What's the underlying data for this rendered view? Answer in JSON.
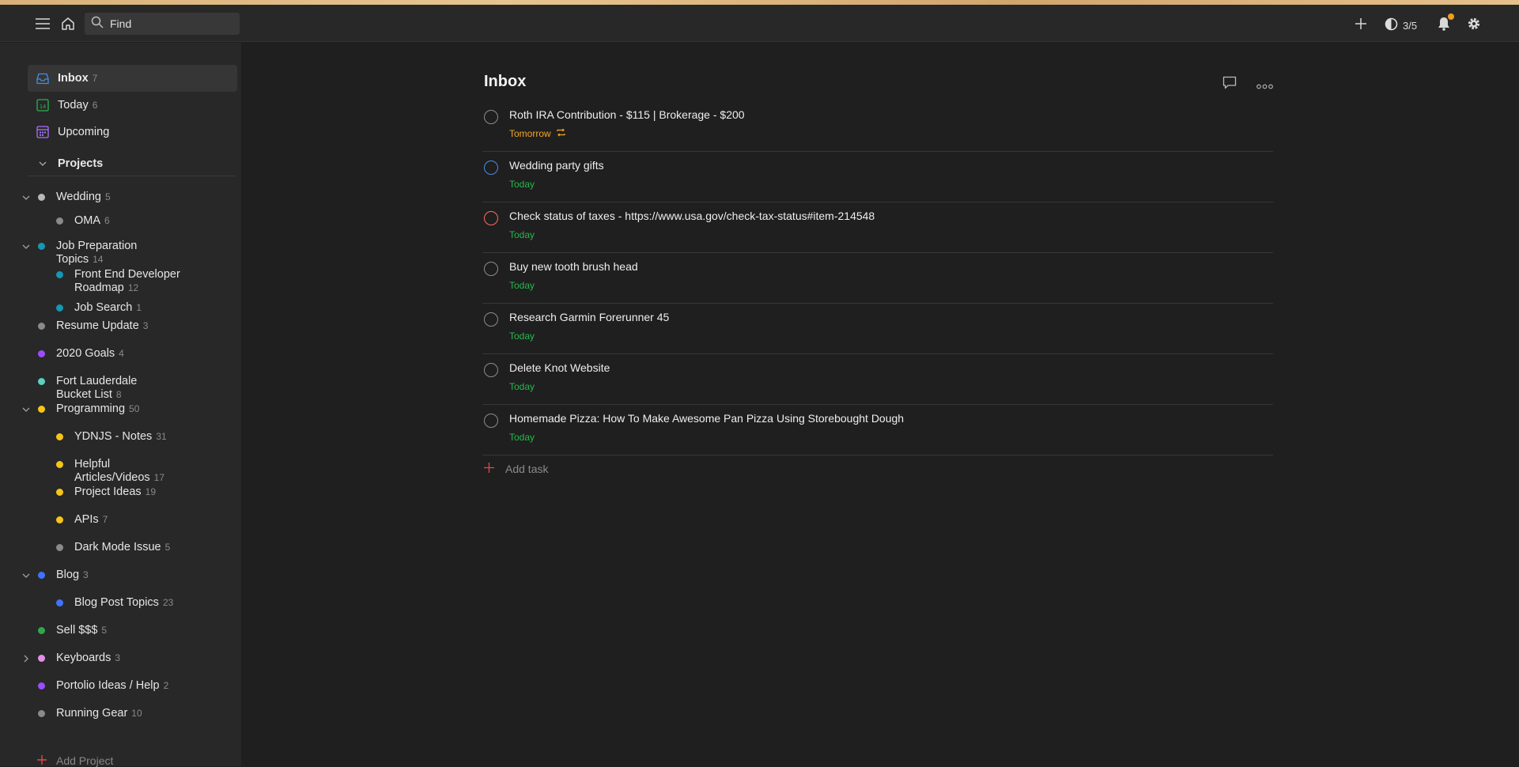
{
  "colors": {
    "accent_red": "#de4c4a",
    "today_green": "#25b84c",
    "tomorrow_orange": "#f5a623",
    "inbox_blue": "#4a8cdf",
    "today_icon_green": "#2bb24c",
    "upcoming_purple": "#a970ff"
  },
  "topbar": {
    "search_placeholder": "Find",
    "karma": "3/5",
    "icons": [
      "menu-icon",
      "home-icon",
      "search-icon",
      "plus-icon",
      "karma-icon",
      "bell-icon",
      "gear-icon"
    ]
  },
  "nav": {
    "inbox": {
      "label": "Inbox",
      "count": "7"
    },
    "today": {
      "label": "Today",
      "count": "6",
      "icon_text": "14"
    },
    "upcoming": {
      "label": "Upcoming"
    },
    "projects_label": "Projects"
  },
  "projects": [
    {
      "name": "Wedding",
      "count": "5",
      "color": "#b8b8b8",
      "expanded": true
    },
    {
      "name": "OMA",
      "count": "6",
      "color": "#8a8a8a"
    },
    {
      "name": "Job Preparation Topics",
      "count": "14",
      "color": "#1597b5",
      "expanded": true
    },
    {
      "name": "Front End Developer Roadmap",
      "count": "12",
      "color": "#1597b5"
    },
    {
      "name": "Job Search",
      "count": "1",
      "color": "#1597b5"
    },
    {
      "name": "Resume Update",
      "count": "3",
      "color": "#8a8a8a"
    },
    {
      "name": "2020 Goals",
      "count": "4",
      "color": "#9b4dff"
    },
    {
      "name": "Fort Lauderdale Bucket List",
      "count": "8",
      "color": "#5ecfc0"
    },
    {
      "name": "Programming",
      "count": "50",
      "color": "#f5c518",
      "expanded": true
    },
    {
      "name": "YDNJS - Notes",
      "count": "31",
      "color": "#f5c518"
    },
    {
      "name": "Helpful Articles/Videos",
      "count": "17",
      "color": "#f5c518"
    },
    {
      "name": "Project Ideas",
      "count": "19",
      "color": "#f5c518"
    },
    {
      "name": "APIs",
      "count": "7",
      "color": "#f5c518"
    },
    {
      "name": "Dark Mode Issue",
      "count": "5",
      "color": "#8a8a8a"
    },
    {
      "name": "Blog",
      "count": "3",
      "color": "#4073ff",
      "expanded": true
    },
    {
      "name": "Blog Post Topics",
      "count": "23",
      "color": "#4073ff"
    },
    {
      "name": "Sell $$$",
      "count": "5",
      "color": "#2ea84a"
    },
    {
      "name": "Keyboards",
      "count": "3",
      "color": "#e68ee8",
      "expanded": false
    },
    {
      "name": "Portolio Ideas / Help",
      "count": "2",
      "color": "#9b4dff"
    },
    {
      "name": "Running Gear",
      "count": "10",
      "color": "#8a8a8a"
    }
  ],
  "add_project_label": "Add Project",
  "main": {
    "title": "Inbox",
    "add_task_label": "Add task",
    "tasks": [
      {
        "name": "Roth IRA Contribution - $115 | Brokerage - $200",
        "due": "Tomorrow",
        "due_color": "#f5a623",
        "priority_color": "#8c8c8c",
        "recurring": true
      },
      {
        "name": "Wedding party gifts",
        "due": "Today",
        "due_color": "#25b84c",
        "priority_color": "#4a8cdf"
      },
      {
        "name": "Check status of taxes - https://www.usa.gov/check-tax-status#item-214548",
        "due": "Today",
        "due_color": "#25b84c",
        "priority_color": "#ff6b5b"
      },
      {
        "name": "Buy new tooth brush head",
        "due": "Today",
        "due_color": "#25b84c",
        "priority_color": "#8c8c8c"
      },
      {
        "name": "Research Garmin Forerunner 45",
        "due": "Today",
        "due_color": "#25b84c",
        "priority_color": "#8c8c8c"
      },
      {
        "name": "Delete Knot Website",
        "due": "Today",
        "due_color": "#25b84c",
        "priority_color": "#8c8c8c"
      },
      {
        "name": "Homemade Pizza: How To Make Awesome Pan Pizza Using Storebought Dough",
        "due": "Today",
        "due_color": "#25b84c",
        "priority_color": "#8c8c8c"
      }
    ]
  }
}
